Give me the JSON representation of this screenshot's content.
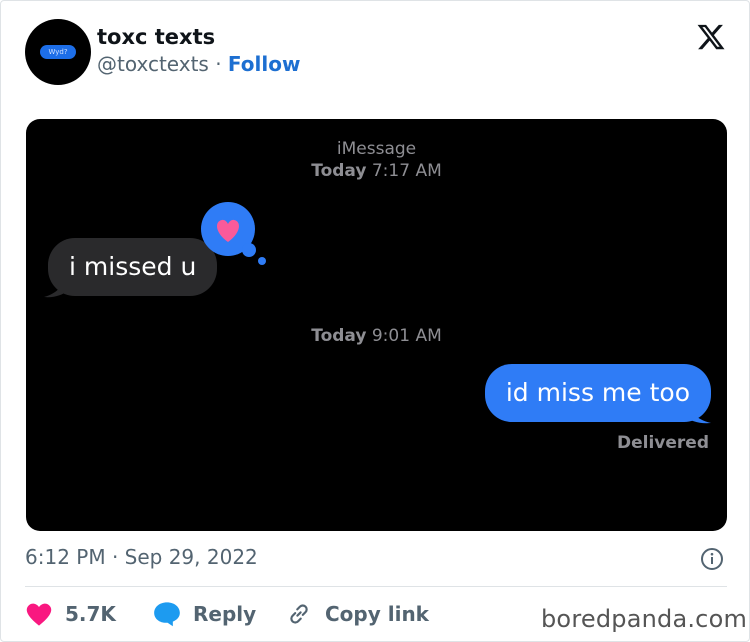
{
  "tweet": {
    "avatar_text": "Wyd?",
    "display_name": "toxc texts",
    "handle": "@toxctexts",
    "separator": " · ",
    "follow_label": "Follow",
    "brand_icon": "x-logo-icon"
  },
  "conversation": {
    "service": "iMessage",
    "timestamp1": {
      "day": "Today",
      "time": "7:17 AM"
    },
    "incoming_message": "i missed u",
    "reaction_icon": "heart-icon",
    "timestamp2": {
      "day": "Today",
      "time": "9:01 AM"
    },
    "outgoing_message": "id miss me too",
    "status": "Delivered"
  },
  "meta": {
    "timestamp": "6:12 PM · Sep 29, 2022"
  },
  "actions": {
    "like_count": "5.7K",
    "reply_label": "Reply",
    "copy_label": "Copy link"
  },
  "watermark": "boredpanda.com",
  "colors": {
    "follow": "#1d6fd1",
    "imessage_blue": "#2f7cf6",
    "incoming_bubble": "#2a2a2c",
    "heart": "#f91880",
    "reply_icon": "#1d9bf0"
  }
}
